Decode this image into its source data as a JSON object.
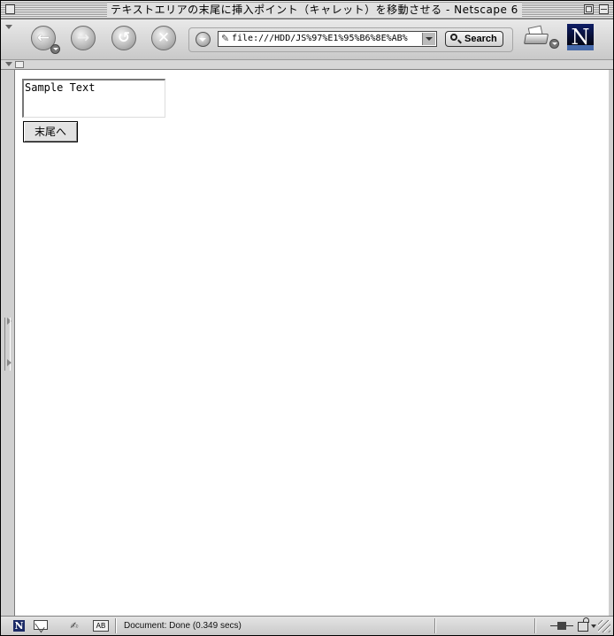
{
  "window": {
    "title": "テキストエリアの末尾に挿入ポイント（キャレット）を移動させる - Netscape 6"
  },
  "toolbar": {
    "back_glyph": "←",
    "forward_glyph": "→",
    "reload_glyph": "↺",
    "stop_glyph": "✕",
    "url": "file:///HDD/JS%97%E1%95%B6%8E%AB%",
    "search_label": "Search",
    "logo_letter": "N"
  },
  "page": {
    "textarea_value": "Sample Text",
    "button_label": "末尾へ"
  },
  "status": {
    "text": "Document: Done (0.349 secs)",
    "netscape_letter": "N",
    "compose_glyph": "✍",
    "addressbook_label": "AB"
  },
  "colors": {
    "chrome": "#dcdcdc",
    "logo_bg": "#0e1e66",
    "content_bg": "#ffffff"
  },
  "icons": {
    "back": "back-arrow-icon",
    "forward": "forward-arrow-icon",
    "reload": "reload-icon",
    "stop": "stop-icon",
    "search": "magnifier-icon",
    "print": "printer-icon",
    "logo": "netscape-logo-icon"
  }
}
